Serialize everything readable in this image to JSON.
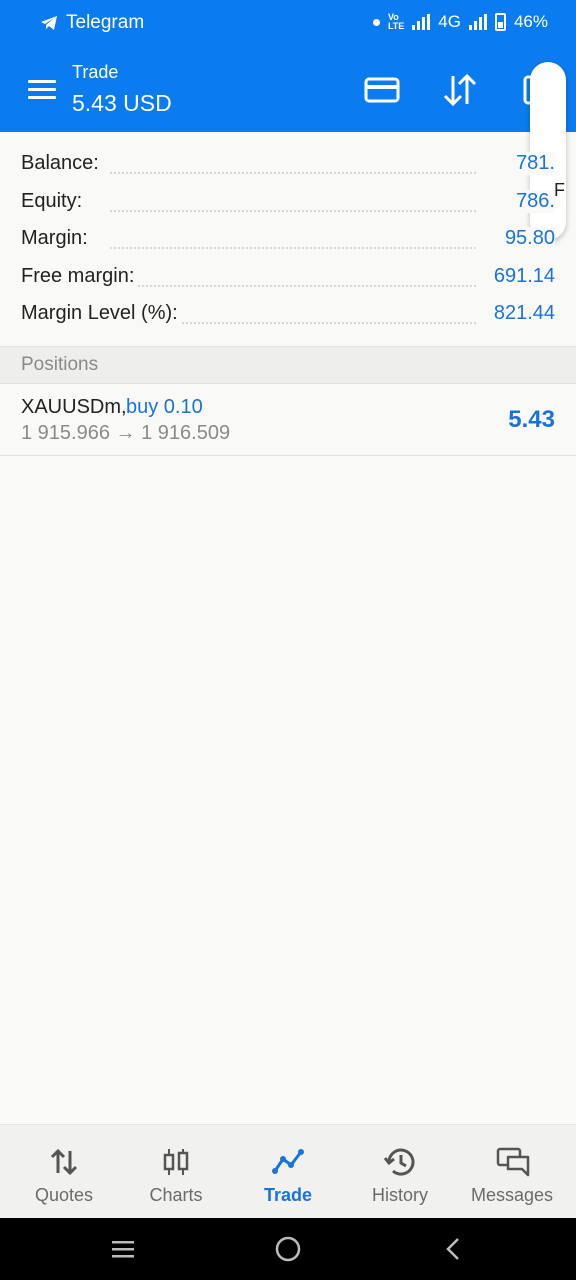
{
  "status_bar": {
    "app_name": "Telegram",
    "network": "4G",
    "battery": "46%"
  },
  "app_bar": {
    "title": "Trade",
    "value": "5.43 USD",
    "icons": [
      "menu-icon",
      "card-icon",
      "sort-icon"
    ]
  },
  "overlay": {
    "letter": "F"
  },
  "summary": [
    {
      "label": "Balance:",
      "value": "781."
    },
    {
      "label": "Equity:",
      "value": "786."
    },
    {
      "label": "Margin:",
      "value": "95.80"
    },
    {
      "label": "Free margin:",
      "value": "691.14"
    },
    {
      "label": "Margin Level (%):",
      "value": "821.44"
    }
  ],
  "positions": {
    "header": "Positions",
    "items": [
      {
        "symbol": "XAUUSDm,",
        "side": "buy 0.10",
        "prices": "1 915.966 → 1 916.509",
        "profit": "5.43"
      }
    ]
  },
  "bottom_nav": [
    {
      "label": "Quotes",
      "icon": "quotes-icon",
      "active": false
    },
    {
      "label": "Charts",
      "icon": "charts-icon",
      "active": false
    },
    {
      "label": "Trade",
      "icon": "trade-icon",
      "active": true
    },
    {
      "label": "History",
      "icon": "history-icon",
      "active": false
    },
    {
      "label": "Messages",
      "icon": "messages-icon",
      "active": false
    }
  ],
  "colors": {
    "accent": "#0b7cf0",
    "value_blue": "#1a73d9",
    "muted_gray": "#8a8a8a"
  }
}
